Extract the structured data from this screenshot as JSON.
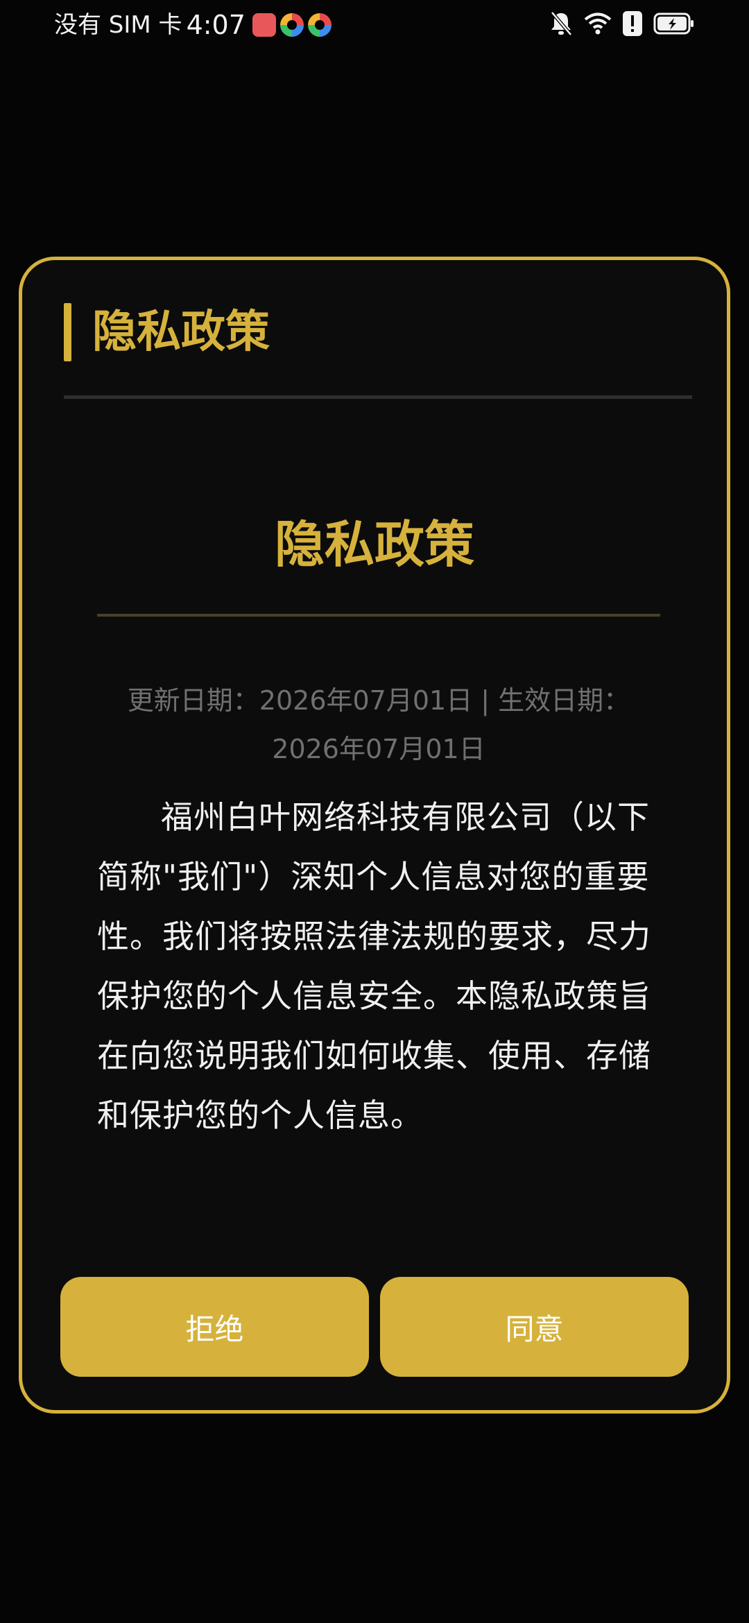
{
  "status_bar": {
    "carrier": "没有 SIM 卡",
    "time": "4:07"
  },
  "dialog": {
    "title": "隐私政策",
    "document": {
      "title": "隐私政策",
      "dates": "更新日期：2026年07月01日 | 生效日期：2026年07月01日",
      "intro": "福州白叶网络科技有限公司（以下简称\"我们\"）深知个人信息对您的重要性。我们将按照法律法规的要求，尽力保护您的个人信息安全。本隐私政策旨在向您说明我们如何收集、使用、存储和保护您的个人信息。"
    },
    "buttons": {
      "reject": "拒绝",
      "agree": "同意"
    }
  },
  "colors": {
    "accent": "#d6b23c",
    "background": "#050505",
    "dialog_background": "#0c0c0c"
  }
}
